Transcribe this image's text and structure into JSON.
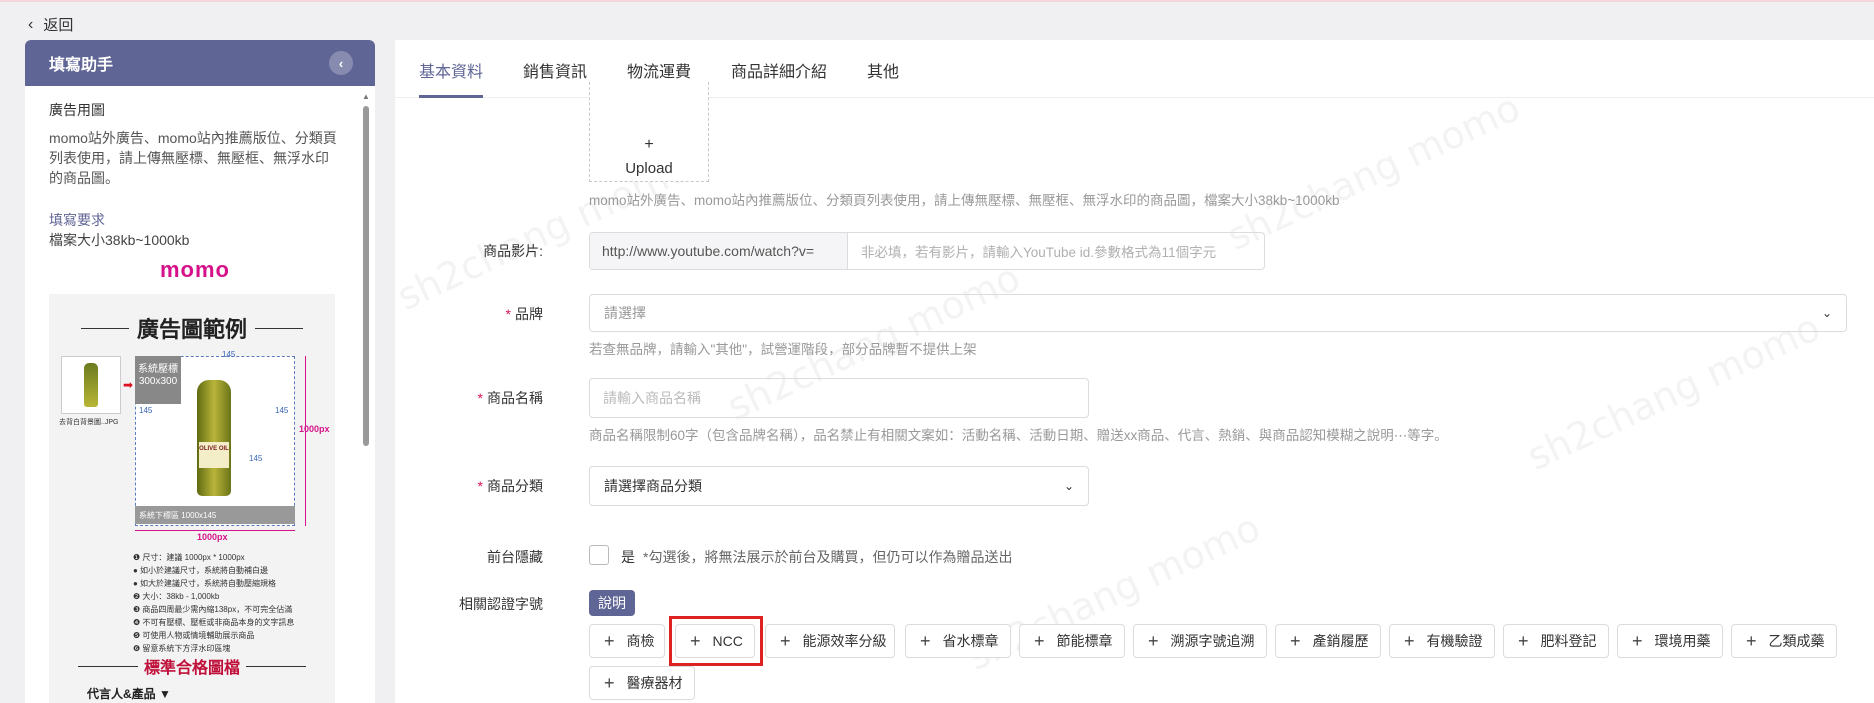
{
  "topbar": {
    "back_label": "返回"
  },
  "helper": {
    "title": "填寫助手",
    "section_title": "廣告用圖",
    "description": "momo站外廣告、momo站內推薦版位、分類頁列表使用，請上傳無壓標、無壓框、無浮水印的商品圖。",
    "req_title": "填寫要求",
    "req_text": "檔案大小38kb~1000kb",
    "logo_text": "momo",
    "example": {
      "title": "廣告圖範例",
      "thumb_caption": "去背白背景圖..JPG",
      "overlay_text": "系統壓標300x300",
      "bar_text": "系統下標區 1000x145",
      "dim_side": "1000px",
      "dim_bottom": "1000px",
      "num_top": "145",
      "num_left": "145",
      "num_right": "145",
      "num_bottom": "145",
      "bottle_label": "OLIVE OIL",
      "notes": [
        "❶ 尺寸：建議 1000px * 1000px",
        "● 如小於建議尺寸，系統將自動補白邊",
        "● 如大於建議尺寸，系統將自動壓縮規格",
        "❷ 大小：38kb - 1,000kb",
        "❸ 商品四周最少需內縮138px，不可完全佔滿",
        "❹ 不可有壓標、壓框或非商品本身的文字訊息",
        "❺ 可使用人物或情境輔助展示商品",
        "❻ 留意系統下方浮水印區塊"
      ],
      "std_title": "標準合格圖檔",
      "spokes_label": "代言人&產品 ▼"
    }
  },
  "tabs": [
    {
      "label": "基本資料",
      "active": true
    },
    {
      "label": "銷售資訊",
      "active": false
    },
    {
      "label": "物流運費",
      "active": false
    },
    {
      "label": "商品詳細介紹",
      "active": false
    },
    {
      "label": "其他",
      "active": false
    }
  ],
  "form": {
    "upload": {
      "plus": "+",
      "label": "Upload"
    },
    "upload_hint": "momo站外廣告、momo站內推薦版位、分類頁列表使用，請上傳無壓標、無壓框、無浮水印的商品圖，檔案大小38kb~1000kb",
    "video": {
      "label": "商品影片:",
      "prefix": "http://www.youtube.com/watch?v=",
      "placeholder": "非必填，若有影片，請輸入YouTube id.參數格式為11個字元"
    },
    "brand": {
      "required_mark": "*",
      "label": "品牌",
      "placeholder": "請選擇",
      "hint": "若查無品牌，請輸入\"其他\"，試營運階段，部分品牌暫不提供上架"
    },
    "name": {
      "required_mark": "*",
      "label": "商品名稱",
      "placeholder": "請輸入商品名稱",
      "hint": "商品名稱限制60字（包含品牌名稱），品名禁止有相關文案如：活動名稱、活動日期、贈送xx商品、代言、熱銷、與商品認知模糊之說明⋯等字。"
    },
    "category": {
      "required_mark": "*",
      "label": "商品分類",
      "placeholder": "請選擇商品分類"
    },
    "hidden": {
      "label": "前台隱藏",
      "option": "是",
      "note": "*勾選後，將無法展示於前台及購買，但仍可以作為贈品送出",
      "checked": false
    },
    "cert": {
      "label": "相關認證字號",
      "explain_label": "說明",
      "items": [
        "商檢",
        "NCC",
        "能源效率分級",
        "省水標章",
        "節能標章",
        "溯源字號追溯",
        "產銷履歷",
        "有機驗證",
        "肥料登記",
        "環境用藥",
        "乙類成藥",
        "醫療器材"
      ],
      "highlighted": "NCC"
    }
  },
  "colors": {
    "accent": "#5f6595",
    "required": "#d6125a",
    "highlight_box": "#dd2222"
  },
  "watermark_text": "sh2chang momo"
}
